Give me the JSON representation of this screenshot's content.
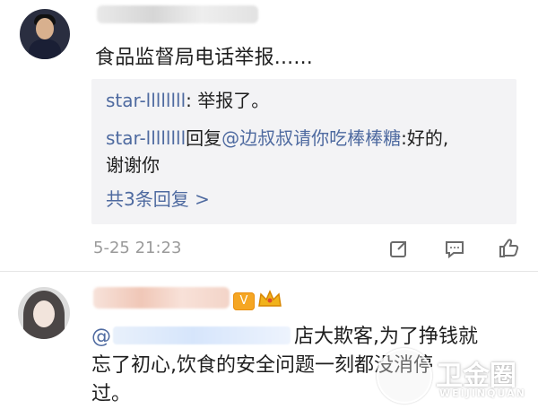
{
  "comment1": {
    "avatar": "user-avatar",
    "text": "食品监督局电话举报......",
    "replies": [
      {
        "user": "star-llllllll",
        "sep": ": ",
        "text": "举报了。"
      },
      {
        "user": "star-llllllll",
        "action": "回复",
        "mention": "@边叔叔请你吃棒棒糖",
        "sep": ":",
        "text": "好的,",
        "text_line2": "谢谢你"
      }
    ],
    "more_replies": "共3条回复 >",
    "timestamp": "5-25 21:23",
    "actions": [
      "share-icon",
      "comment-icon",
      "like-icon"
    ]
  },
  "comment2": {
    "avatar": "user-avatar",
    "badge": "V",
    "crown": "crown-icon",
    "mention_prefix": "@",
    "text_tail": "店大欺客,为了挣钱就",
    "text_line2": "忘了初心,饮食的安全问题一刻都没消停",
    "text_line3": "过。"
  },
  "watermark": {
    "title": "卫金圈",
    "subtitle": "WEIJINQUAN"
  },
  "colors": {
    "link": "#4e6aa0",
    "timestamp": "#9a9a9a",
    "reply_bg": "#f3f3f5",
    "badge": "#f5a623"
  }
}
